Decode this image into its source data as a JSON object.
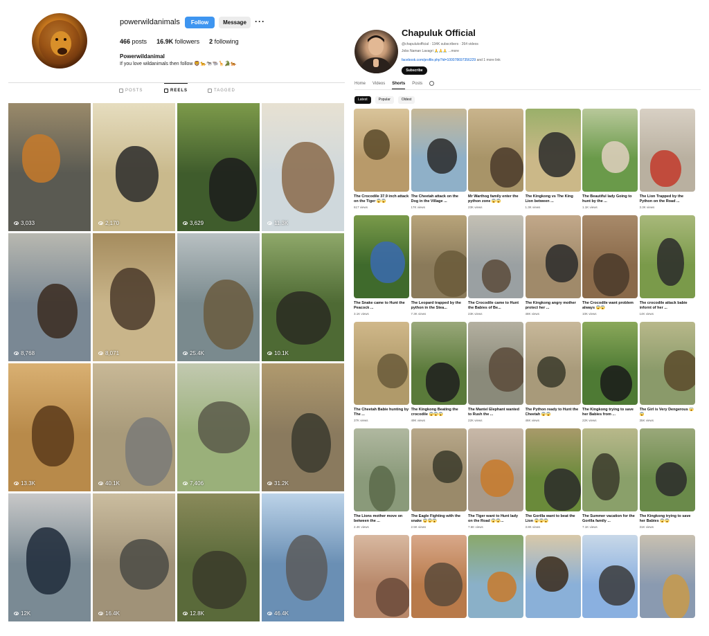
{
  "instagram": {
    "username": "powerwildanimals",
    "follow_label": "Follow",
    "message_label": "Message",
    "more_label": "···",
    "stats": {
      "posts": "466",
      "posts_label": "posts",
      "followers": "16.9K",
      "followers_label": "followers",
      "following": "2",
      "following_label": "following"
    },
    "bio_name": "Powerwildanimal",
    "bio_text": "If you love wildanimals then follow 🦁🐆🐄🐃🦒🐊🐅",
    "tabs": [
      {
        "label": "POSTS"
      },
      {
        "label": "REELS"
      },
      {
        "label": "TAGGED"
      }
    ],
    "active_tab": "REELS",
    "reels": [
      {
        "views": "3,033",
        "colors": [
          "#5a5a52",
          "#9a8a6a",
          "#c77a2a"
        ]
      },
      {
        "views": "2,170",
        "colors": [
          "#c9b98c",
          "#e6ddbf",
          "#2a2a2a"
        ]
      },
      {
        "views": "3,629",
        "colors": [
          "#3f5c2c",
          "#7d9a4a",
          "#1c1c1c"
        ]
      },
      {
        "views": "11.3K",
        "colors": [
          "#cfd8dc",
          "#e7e1d2",
          "#8a6a4a"
        ]
      },
      {
        "views": "8,768",
        "colors": [
          "#7a8894",
          "#b8b8b0",
          "#3a2a1e"
        ]
      },
      {
        "views": "8,071",
        "colors": [
          "#c9b58a",
          "#a58c5e",
          "#4a3a2a"
        ]
      },
      {
        "views": "25.4K",
        "colors": [
          "#7a8a8e",
          "#b8c0c2",
          "#6a5a3e"
        ]
      },
      {
        "views": "10.1K",
        "colors": [
          "#4e6a34",
          "#8fa86a",
          "#2a2a22"
        ]
      },
      {
        "views": "13.3K",
        "colors": [
          "#b88a4a",
          "#d9b072",
          "#5a3a1a"
        ]
      },
      {
        "views": "40.1K",
        "colors": [
          "#a89a7a",
          "#c8b896",
          "#7a7a78"
        ]
      },
      {
        "views": "7,406",
        "colors": [
          "#9ab07a",
          "#c2c9b0",
          "#5a5a4a"
        ]
      },
      {
        "views": "31.2K",
        "colors": [
          "#8a7a5e",
          "#b09a6e",
          "#3a3a2e"
        ]
      },
      {
        "views": "12K",
        "colors": [
          "#7a8a94",
          "#c8c8c8",
          "#1e2a3a"
        ]
      },
      {
        "views": "16.4K",
        "colors": [
          "#a09278",
          "#cbbd9f",
          "#4a4a44"
        ]
      },
      {
        "views": "12.8K",
        "colors": [
          "#5a6a3a",
          "#8a8a5a",
          "#3a3a2a"
        ]
      },
      {
        "views": "46.4K",
        "colors": [
          "#6a8fb4",
          "#bcd3e8",
          "#5a5a5a"
        ]
      }
    ]
  },
  "youtube": {
    "channel_name": "Chapuluk Official",
    "channel_meta": "@chapulukofficial · 134K subscribers · 264 videos",
    "channel_desc": "Jobs Naman Lavagri 🙏🙏🙏 ...more",
    "channel_link": "facebook.com/profile.php?id=100078697356229",
    "channel_link_more": "and 1 more link",
    "subscribe_label": "Subscribe",
    "tabs": [
      {
        "label": "Home"
      },
      {
        "label": "Videos"
      },
      {
        "label": "Shorts"
      },
      {
        "label": "Posts"
      }
    ],
    "active_tab": "Shorts",
    "chips": [
      {
        "label": "Latest"
      },
      {
        "label": "Popular"
      },
      {
        "label": "Oldest"
      }
    ],
    "active_chip": "Latest",
    "shorts": [
      {
        "title": "The Crocodile 37.9 inch attack on the Tiger 😱😱",
        "views": "617 views",
        "colors": [
          "#b89a6a",
          "#d9c49a",
          "#5a4a2a"
        ]
      },
      {
        "title": "The Cheetah attack on the Dog in the Village ...",
        "views": "17K views",
        "colors": [
          "#8fb0c8",
          "#c6b898",
          "#2a2a2a"
        ]
      },
      {
        "title": "Mr Warthog family enter the python zone 😱😱",
        "views": "23K views",
        "colors": [
          "#a89468",
          "#c9b48c",
          "#4a3a2a"
        ]
      },
      {
        "title": "The Kingkong vs The King Lion between ...",
        "views": "1.3K views",
        "colors": [
          "#cbb888",
          "#9ab06a",
          "#2a2a2a"
        ]
      },
      {
        "title": "The Beautiful lady Going to hunt by the ...",
        "views": "1.1K views",
        "colors": [
          "#6a9a4a",
          "#b8c89a",
          "#e0d0c0"
        ]
      },
      {
        "title": "The Lion Trapped by the Python on the Road ...",
        "views": "3.3K views",
        "colors": [
          "#b9b0a0",
          "#d8d0c4",
          "#c23a2a"
        ]
      },
      {
        "title": "The Snake came to Hunt the Peacock ...",
        "views": "3.1K views",
        "colors": [
          "#3f6a2c",
          "#7a9a4a",
          "#3a6ab0"
        ]
      },
      {
        "title": "The Leopard trapped by the python in the Stea...",
        "views": "7.3K views",
        "colors": [
          "#8a7a5a",
          "#b8a47a",
          "#6a5a3a"
        ]
      },
      {
        "title": "The Crocodile came to Hunt the Babies of Be...",
        "views": "23K views",
        "colors": [
          "#9aa0a2",
          "#c4c0b4",
          "#5a4a3a"
        ]
      },
      {
        "title": "The Kingkong angry mother protect her ...",
        "views": "48K views",
        "colors": [
          "#a08a6a",
          "#c2a88a",
          "#2a2a2a"
        ]
      },
      {
        "title": "The Crocodile want problem always 😱😱",
        "views": "10K views",
        "colors": [
          "#8a6a4a",
          "#a88a6a",
          "#4a3a2a"
        ]
      },
      {
        "title": "The crocodile attack babie infornt of her ...",
        "views": "14K views",
        "colors": [
          "#7a9a4a",
          "#a8b87a",
          "#2a2a2a"
        ]
      },
      {
        "title": "The Cheetah Babie hunting by The ...",
        "views": "37K views",
        "colors": [
          "#b09a6a",
          "#d0b88a",
          "#6a5a3a"
        ]
      },
      {
        "title": "The Kingkong Beating the crocodile 😱😱😱",
        "views": "49K views",
        "colors": [
          "#5a7a3a",
          "#9aa87a",
          "#1e1e1e"
        ]
      },
      {
        "title": "The Mantel Elephant wanted to Rush the ...",
        "views": "22K views",
        "colors": [
          "#8a8a7a",
          "#b4b0a0",
          "#5a4a3a"
        ]
      },
      {
        "title": "The Python ready to Hunt the Cheetah 😱😱",
        "views": "46K views",
        "colors": [
          "#a89a7a",
          "#c8b89a",
          "#3a3a2a"
        ]
      },
      {
        "title": "The Kingkong trying to save her Babies from ...",
        "views": "22K views",
        "colors": [
          "#4e7a34",
          "#8aa85a",
          "#1a1a1a"
        ]
      },
      {
        "title": "The Girl is Very Dengerous 😱😱",
        "views": "35K views",
        "colors": [
          "#8a9a6a",
          "#b8b88a",
          "#5a4a2a"
        ]
      },
      {
        "title": "The Lions mother move on between the ...",
        "views": "2.4K views",
        "colors": [
          "#8a9a7a",
          "#b0b8a0",
          "#5a6a4a"
        ]
      },
      {
        "title": "The Eagle Fighting with the snake 😱😱😱",
        "views": "2.5K views",
        "colors": [
          "#9a8a6a",
          "#b8a88a",
          "#3a3a2a"
        ]
      },
      {
        "title": "The Tiger want to Hunt lady on the Road 😱😱...",
        "views": "7.6K views",
        "colors": [
          "#a89a8a",
          "#c8b8a8",
          "#c87a2a"
        ]
      },
      {
        "title": "The Gorilla want to beat the Lion 😱😱😱",
        "views": "3.8K views",
        "colors": [
          "#6a8a3a",
          "#a89a6a",
          "#2a2a2a"
        ]
      },
      {
        "title": "The Summer vacation for the Gorilla family ...",
        "views": "7.1K views",
        "colors": [
          "#8aa06a",
          "#b8b88a",
          "#3a3a2a"
        ]
      },
      {
        "title": "The Kingkong trying to save her Babies 😱😱",
        "views": "31K views",
        "colors": [
          "#6a8a4a",
          "#9aa87a",
          "#2a2a2a"
        ]
      },
      {
        "title": "",
        "views": "",
        "colors": [
          "#b8886a",
          "#d8b8a0",
          "#6a4a3a"
        ]
      },
      {
        "title": "",
        "views": "",
        "colors": [
          "#b87a4a",
          "#d8a88a",
          "#5a4a3a"
        ]
      },
      {
        "title": "",
        "views": "",
        "colors": [
          "#8ab0c8",
          "#8aa86a",
          "#c87a2a"
        ]
      },
      {
        "title": "",
        "views": "",
        "colors": [
          "#8ab0d8",
          "#d8c8a8",
          "#3a2a1a"
        ]
      },
      {
        "title": "",
        "views": "",
        "colors": [
          "#8ab0e0",
          "#c8d8e8",
          "#3a3a3a"
        ]
      },
      {
        "title": "",
        "views": "",
        "colors": [
          "#8a9ab0",
          "#c8c0b0",
          "#c89a4a"
        ]
      }
    ]
  }
}
